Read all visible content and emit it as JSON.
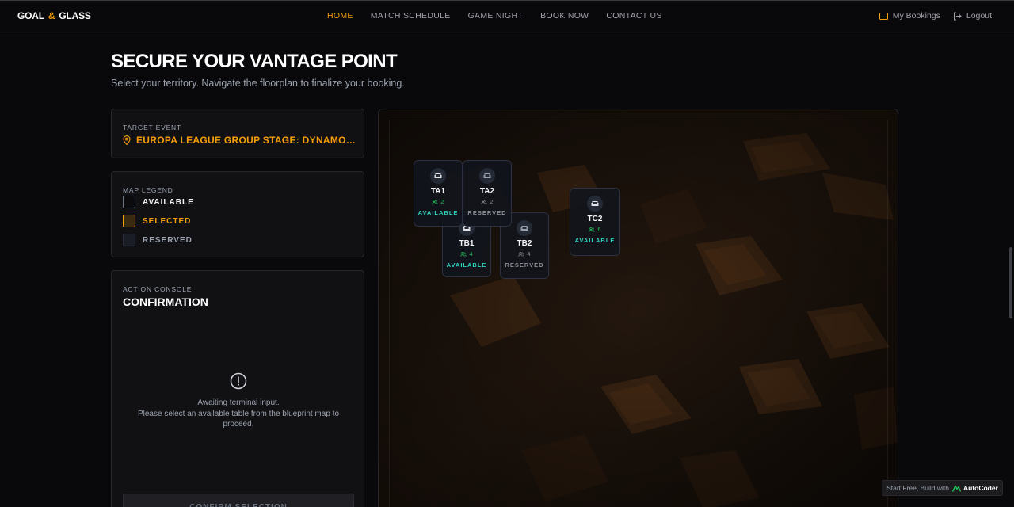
{
  "brand": {
    "part1": "GOAL",
    "amp": "&",
    "part2": "GLASS"
  },
  "nav": {
    "links": [
      "HOME",
      "MATCH SCHEDULE",
      "GAME NIGHT",
      "BOOK NOW",
      "CONTACT US"
    ],
    "active": "HOME",
    "my_bookings": "My Bookings",
    "logout": "Logout"
  },
  "header": {
    "title": "SECURE YOUR VANTAGE POINT",
    "subtitle": "Select your territory. Navigate the floorplan to finalize your booking."
  },
  "event": {
    "label": "TARGET EVENT",
    "name": "EUROPA LEAGUE GROUP STAGE: DYNAMO FC VS ATLETICO"
  },
  "legend": {
    "label": "MAP LEGEND",
    "available": "AVAILABLE",
    "selected": "SELECTED",
    "reserved": "RESERVED"
  },
  "console": {
    "label": "ACTION CONSOLE",
    "title": "CONFIRMATION",
    "awaiting": "Awaiting terminal input.",
    "instruction": "Please select an available table from the blueprint map to proceed.",
    "confirm_button": "CONFIRM SELECTION"
  },
  "tables": [
    {
      "id": "TA1",
      "seats": "2",
      "status": "AVAILABLE"
    },
    {
      "id": "TA2",
      "seats": "2",
      "status": "RESERVED"
    },
    {
      "id": "TB1",
      "seats": "4",
      "status": "AVAILABLE"
    },
    {
      "id": "TB2",
      "seats": "4",
      "status": "RESERVED"
    },
    {
      "id": "TC2",
      "seats": "6",
      "status": "AVAILABLE"
    }
  ],
  "badge": {
    "text": "Start Free, Build with",
    "brand": "AutoCoder"
  },
  "colors": {
    "accent": "#f59e0b",
    "available": "#2dd4bf",
    "seats_available": "#22c55e",
    "background": "#09090b"
  }
}
